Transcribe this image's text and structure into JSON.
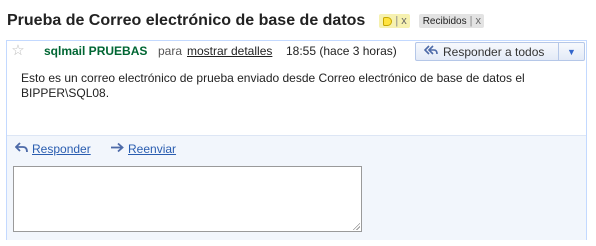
{
  "subject": "Prueba de Correo electrónico de base de datos",
  "labels": [
    {
      "name": "",
      "color": "#f6f1b0",
      "icon": "yellow-label-dot-icon",
      "remove": "x"
    },
    {
      "name": "Recibidos",
      "color": "#e3e3e3",
      "remove": "x"
    }
  ],
  "message": {
    "sender": "sqlmail PRUEBAS",
    "to_prefix": "para",
    "show_details": "mostrar detalles",
    "time": "18:55 (hace 3 horas)",
    "reply_all": "Responder a todos",
    "dropdown_icon": "triangle-down-icon",
    "body": "Esto es un correo electrónico de prueba enviado desde Correo electrónico de base de datos el BIPPER\\SQL08."
  },
  "actions": {
    "reply": "Responder",
    "forward": "Reenviar"
  },
  "reply_box": {
    "value": ""
  },
  "colors": {
    "sender": "#006633",
    "link": "#2a5db0",
    "card_border": "#c3d9ff",
    "reply_area_bg": "#f2f6fc"
  }
}
